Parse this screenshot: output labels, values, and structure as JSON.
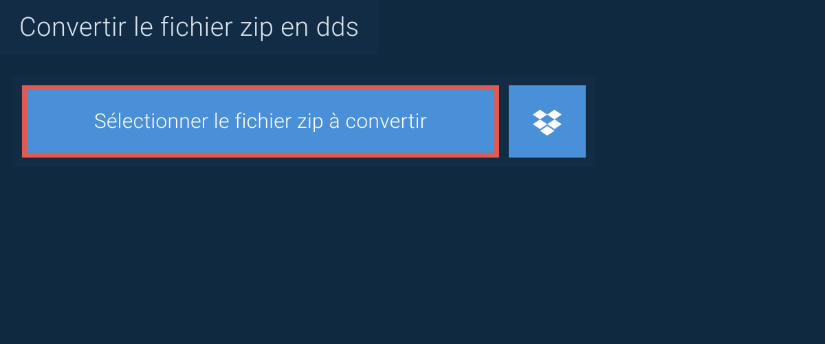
{
  "header": {
    "title": "Convertir le fichier zip en dds"
  },
  "upload": {
    "select_file_label": "Sélectionner le fichier zip à convertir"
  }
}
